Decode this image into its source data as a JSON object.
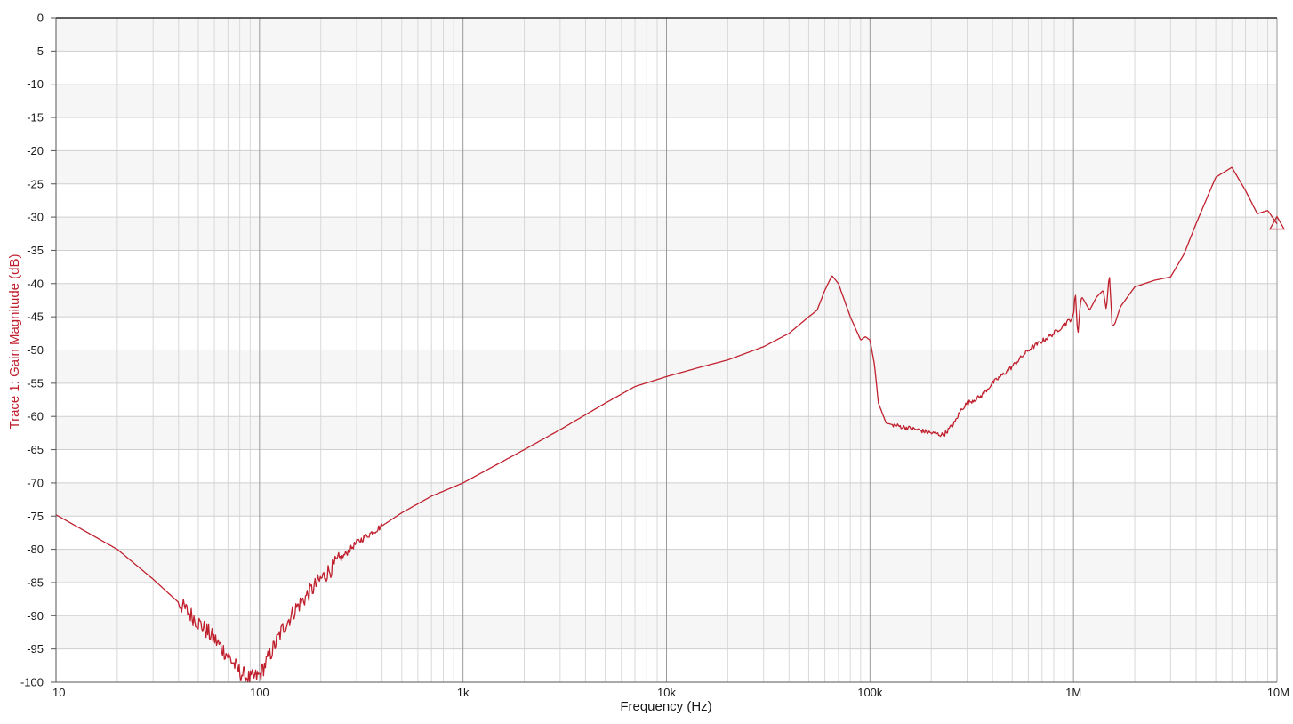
{
  "chart_data": {
    "type": "line",
    "xlabel": "Frequency (Hz)",
    "ylabel": "Trace 1: Gain Magnitude (dB)",
    "x_scale": "log",
    "xlim": [
      10,
      10000000
    ],
    "ylim": [
      -100,
      0
    ],
    "grid": true,
    "x_ticks": [
      {
        "value": 10,
        "label": "10"
      },
      {
        "value": 100,
        "label": "100"
      },
      {
        "value": 1000,
        "label": "1k"
      },
      {
        "value": 10000,
        "label": "10k"
      },
      {
        "value": 100000,
        "label": "100k"
      },
      {
        "value": 1000000,
        "label": "1M"
      },
      {
        "value": 10000000,
        "label": "10M"
      }
    ],
    "y_ticks": [
      {
        "value": 0,
        "label": "0"
      },
      {
        "value": -5,
        "label": "-5"
      },
      {
        "value": -10,
        "label": "-10"
      },
      {
        "value": -15,
        "label": "-15"
      },
      {
        "value": -20,
        "label": "-20"
      },
      {
        "value": -25,
        "label": "-25"
      },
      {
        "value": -30,
        "label": "-30"
      },
      {
        "value": -35,
        "label": "-35"
      },
      {
        "value": -40,
        "label": "-40"
      },
      {
        "value": -45,
        "label": "-45"
      },
      {
        "value": -50,
        "label": "-50"
      },
      {
        "value": -55,
        "label": "-55"
      },
      {
        "value": -60,
        "label": "-60"
      },
      {
        "value": -65,
        "label": "-65"
      },
      {
        "value": -70,
        "label": "-70"
      },
      {
        "value": -75,
        "label": "-75"
      },
      {
        "value": -80,
        "label": "-80"
      },
      {
        "value": -85,
        "label": "-85"
      },
      {
        "value": -90,
        "label": "-90"
      },
      {
        "value": -95,
        "label": "-95"
      },
      {
        "value": -100,
        "label": "-100"
      }
    ],
    "series": [
      {
        "color": "#c0202e",
        "x": [
          10,
          20,
          30,
          40,
          50,
          60,
          70,
          80,
          90,
          100,
          110,
          130,
          150,
          200,
          300,
          500,
          700,
          1000,
          2000,
          3000,
          5000,
          7000,
          10000,
          15000,
          20000,
          30000,
          40000,
          50000,
          55000,
          60000,
          65000,
          70000,
          80000,
          90000,
          95000,
          100000,
          105000,
          110000,
          120000,
          140000,
          170000,
          200000,
          230000,
          260000,
          280000,
          300000,
          350000,
          400000,
          500000,
          600000,
          800000,
          1000000,
          1020000,
          1050000,
          1080000,
          1100000,
          1200000,
          1300000,
          1400000,
          1450000,
          1500000,
          1550000,
          1600000,
          1700000,
          2000000,
          2500000,
          3000000,
          3500000,
          4000000,
          5000000,
          6000000,
          7000000,
          8000000,
          9000000,
          10000000
        ],
        "y": [
          -74.8,
          -80,
          -84.5,
          -88,
          -91,
          -93.5,
          -96,
          -98.5,
          -99.5,
          -99,
          -96.5,
          -92,
          -89,
          -84.5,
          -79,
          -74.5,
          -72,
          -70,
          -65,
          -62,
          -58,
          -55.5,
          -54,
          -52.5,
          -51.5,
          -49.5,
          -47.5,
          -45,
          -44,
          -41,
          -38.8,
          -40,
          -45,
          -48.5,
          -48,
          -48.5,
          -52,
          -58,
          -61,
          -61.5,
          -62,
          -62.5,
          -62.8,
          -61,
          -59,
          -58,
          -57,
          -55,
          -52.5,
          -50,
          -47.5,
          -45,
          -41,
          -48,
          -43,
          -42,
          -44,
          -42,
          -41,
          -44,
          -38.5,
          -46.5,
          -46,
          -43.5,
          -40.5,
          -39.5,
          -39,
          -35.5,
          -31,
          -24,
          -22.5,
          -26,
          -29.5,
          -29,
          -31
        ]
      }
    ]
  }
}
